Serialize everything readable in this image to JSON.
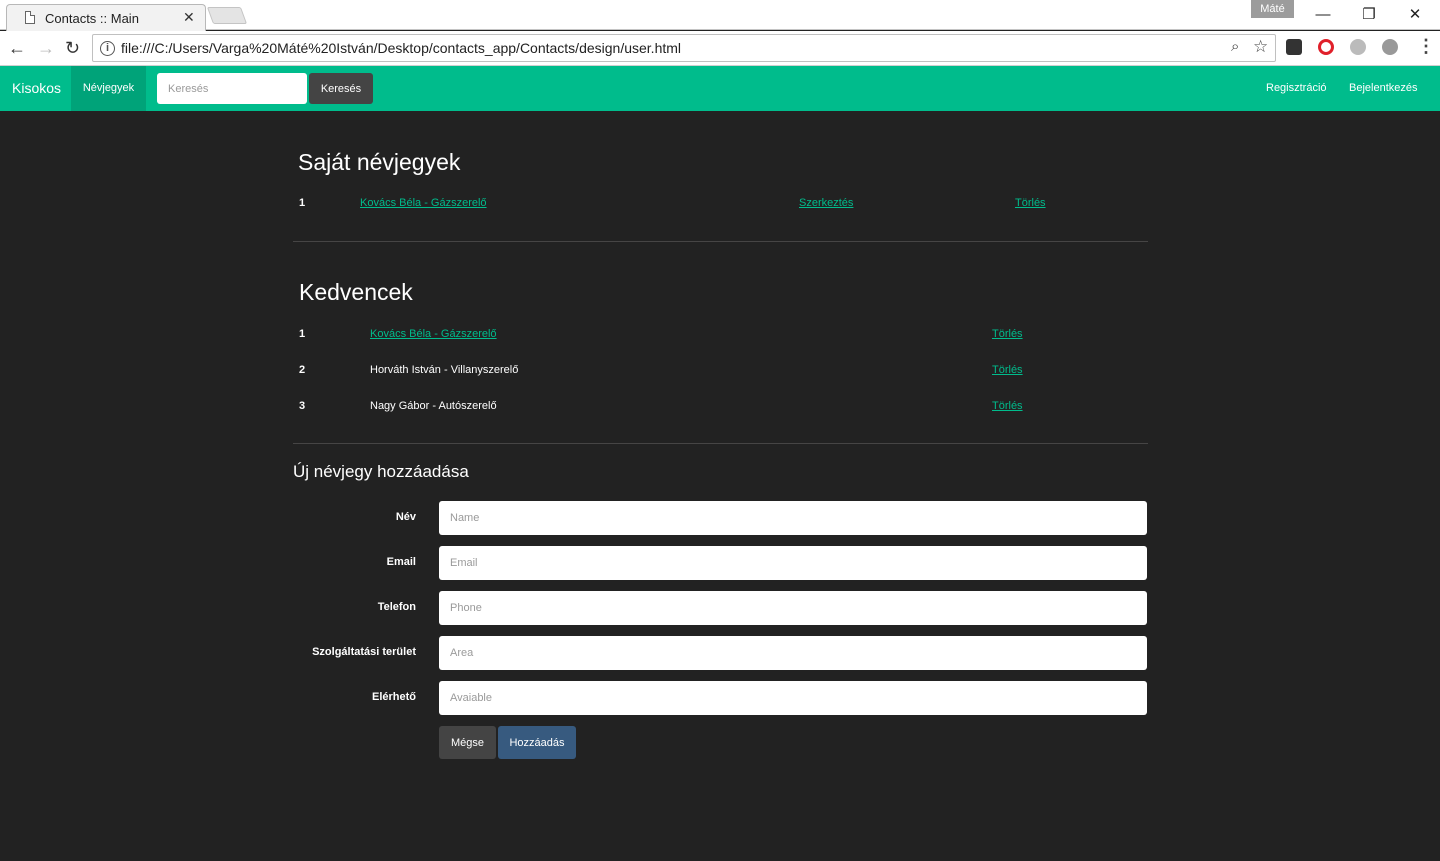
{
  "browser": {
    "tab_title": "Contacts :: Main",
    "profile_name": "Máté",
    "url": "file:///C:/Users/Varga%20Máté%20István/Desktop/contacts_app/Contacts/design/user.html"
  },
  "navbar": {
    "brand": "Kisokos",
    "active_item": "Névjegyek",
    "search_placeholder": "Keresés",
    "search_button": "Keresés",
    "register": "Regisztráció",
    "login": "Bejelentkezés",
    "accent_color": "#00bc8c"
  },
  "own_contacts": {
    "title": "Saját névjegyek",
    "rows": [
      {
        "index": "1",
        "name": "Kovács Béla - Gázszerelő",
        "edit": "Szerkeztés",
        "delete": "Törlés"
      }
    ]
  },
  "favorites": {
    "title": "Kedvencek",
    "rows": [
      {
        "index": "1",
        "name": "Kovács Béla - Gázszerelő",
        "delete": "Törlés"
      },
      {
        "index": "2",
        "name": "Horváth István - Villanyszerelő",
        "delete": "Törlés"
      },
      {
        "index": "3",
        "name": "Nagy Gábor - Autószerelő",
        "delete": "Törlés"
      }
    ]
  },
  "new_contact_form": {
    "title": "Új névjegy hozzáadása",
    "fields": [
      {
        "label": "Név",
        "placeholder": "Name"
      },
      {
        "label": "Email",
        "placeholder": "Email"
      },
      {
        "label": "Telefon",
        "placeholder": "Phone"
      },
      {
        "label": "Szolgáltatási terület",
        "placeholder": "Area"
      },
      {
        "label": "Elérhető",
        "placeholder": "Avaiable"
      }
    ],
    "cancel": "Mégse",
    "submit": "Hozzáadás"
  }
}
